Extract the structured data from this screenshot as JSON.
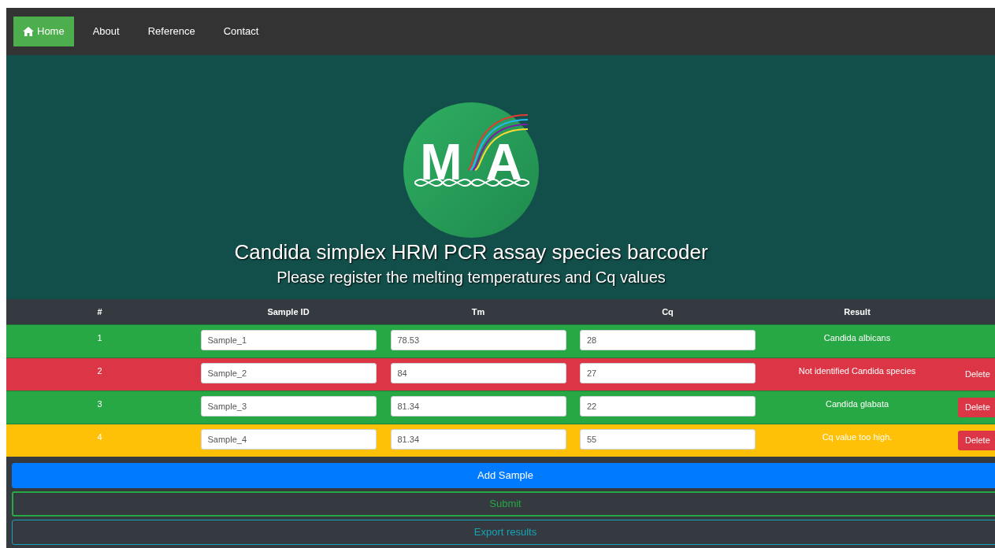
{
  "nav": [
    {
      "label": "Home",
      "selected": true
    },
    {
      "label": "About",
      "selected": false
    },
    {
      "label": "Reference",
      "selected": false
    },
    {
      "label": "Contact",
      "selected": false
    }
  ],
  "hero": {
    "logo": {
      "letters": [
        "M",
        "A"
      ]
    },
    "title": "Candida simplex HRM PCR assay species barcoder",
    "subtitle": "Please register the melting temperatures and Cq values"
  },
  "table": {
    "columns": [
      "#",
      "Sample ID",
      "Tm",
      "Cq",
      "Result"
    ],
    "rows": [
      {
        "number": "1",
        "sample_id": "Sample_1",
        "tm": "78.53",
        "cq": "28",
        "result": "Candida albicans",
        "color": "#28a745"
      },
      {
        "number": "2",
        "sample_id": "Sample_2",
        "tm": "84",
        "cq": "27",
        "result": "Not identified Candida species",
        "color": "#dc3545",
        "delete": {
          "label": "Delete",
          "kind": "plain"
        }
      },
      {
        "number": "3",
        "sample_id": "Sample_3",
        "tm": "81.34",
        "cq": "22",
        "result": "Candida glabata",
        "color": "#28a745",
        "delete": {
          "label": "Delete",
          "kind": "filled"
        }
      },
      {
        "number": "4",
        "sample_id": "Sample_4",
        "tm": "81.34",
        "cq": "55",
        "result": "Cq value too high.",
        "color": "#ffc107",
        "delete": {
          "label": "Delete",
          "kind": "filled"
        }
      }
    ]
  },
  "actions": [
    {
      "label": "Add Sample",
      "kind": "primary"
    },
    {
      "label": "Submit",
      "kind": "outline-success"
    },
    {
      "label": "Export results",
      "kind": "outline-info"
    }
  ]
}
